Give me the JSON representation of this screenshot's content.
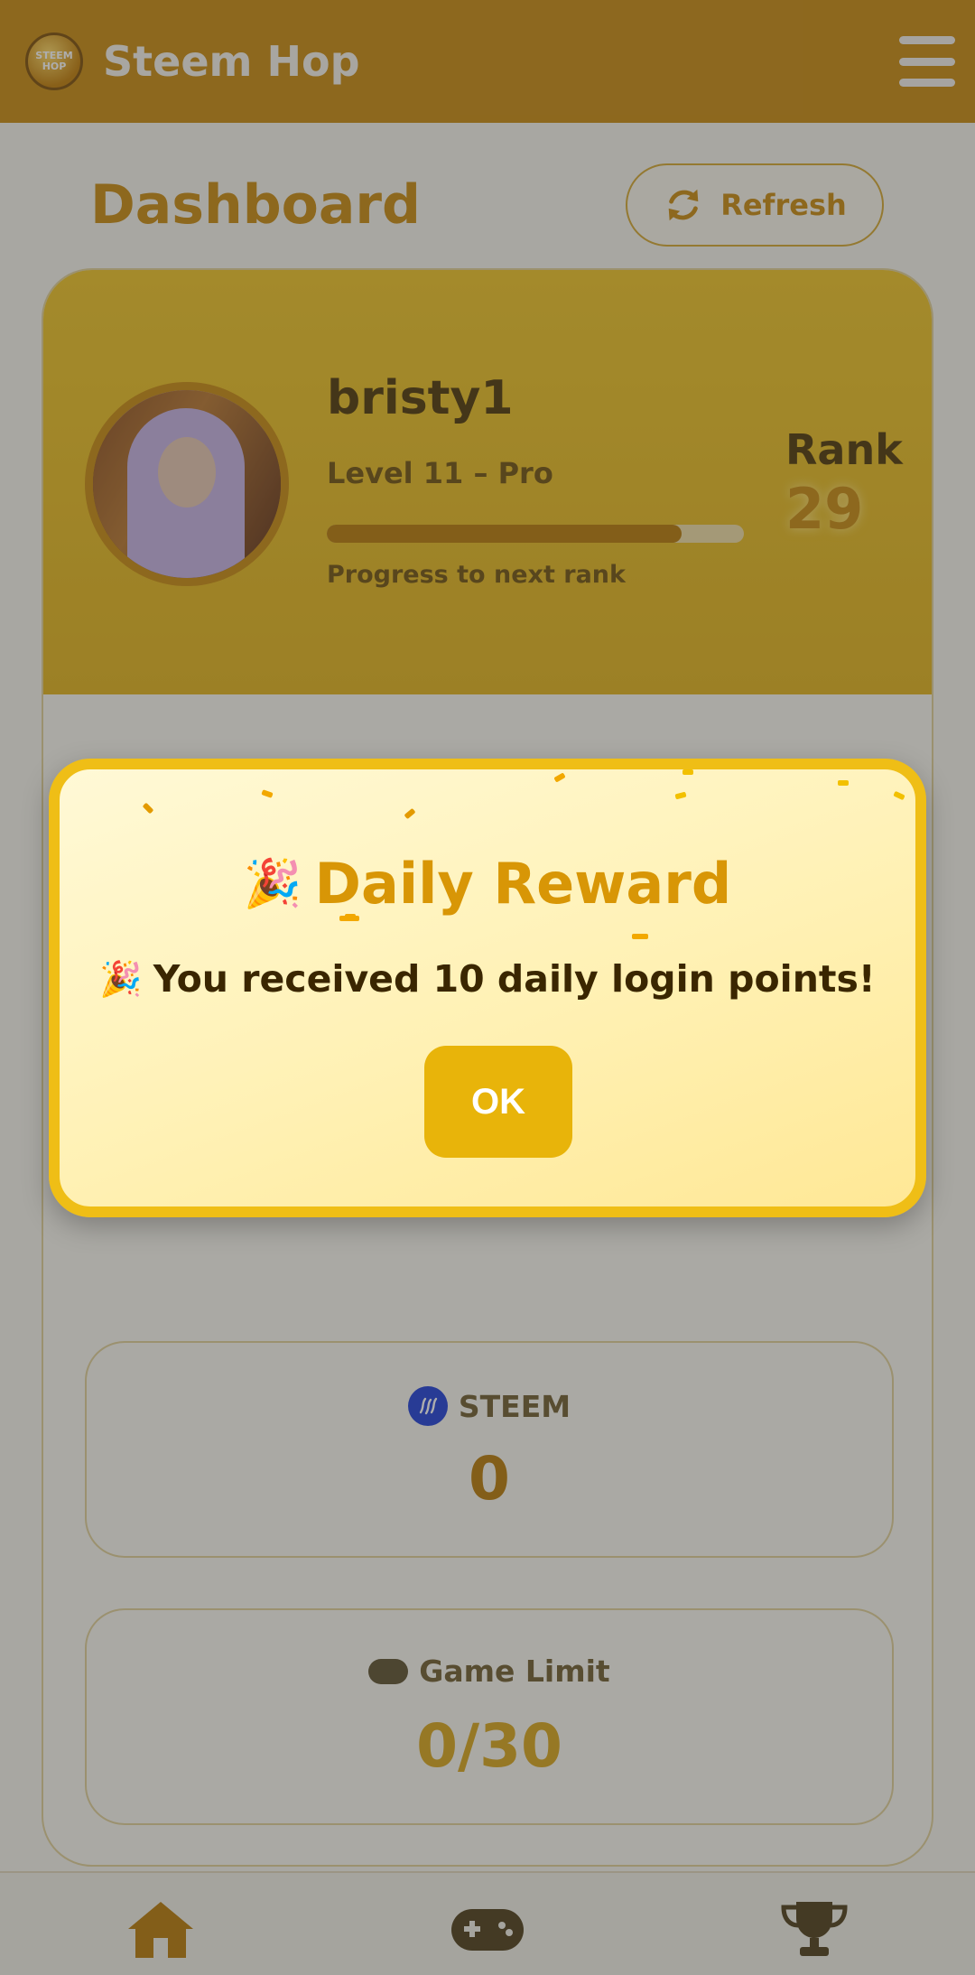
{
  "header": {
    "logo_text": "STEEM HOP",
    "title": "Steem Hop",
    "menu_icon": "hamburger-icon"
  },
  "dashboard": {
    "title": "Dashboard",
    "refresh_label": "Refresh",
    "refresh_icon": "sync-icon"
  },
  "profile": {
    "username": "bristy1",
    "level": "Level 11 – Pro",
    "progress_fraction": 0.85,
    "progress_label": "Progress to next rank",
    "rank_label": "Rank",
    "rank_value": "29"
  },
  "stats": [
    {
      "label": "STEEM",
      "value": "0",
      "icon": "steem-icon"
    },
    {
      "label": "Game Limit",
      "value": "0/30",
      "icon": "gamepad-icon"
    }
  ],
  "nav": {
    "home_icon": "home-icon",
    "games_icon": "gamepad-icon",
    "leaderboard_icon": "trophy-icon"
  },
  "modal": {
    "title": "Daily Reward",
    "message": "You received 10 daily login points!",
    "ok_label": "OK",
    "party_icon": "party-popper-icon"
  },
  "colors": {
    "brand": "#c8880a",
    "accent": "#efbe16",
    "steem_blue": "#1a3bd6"
  }
}
